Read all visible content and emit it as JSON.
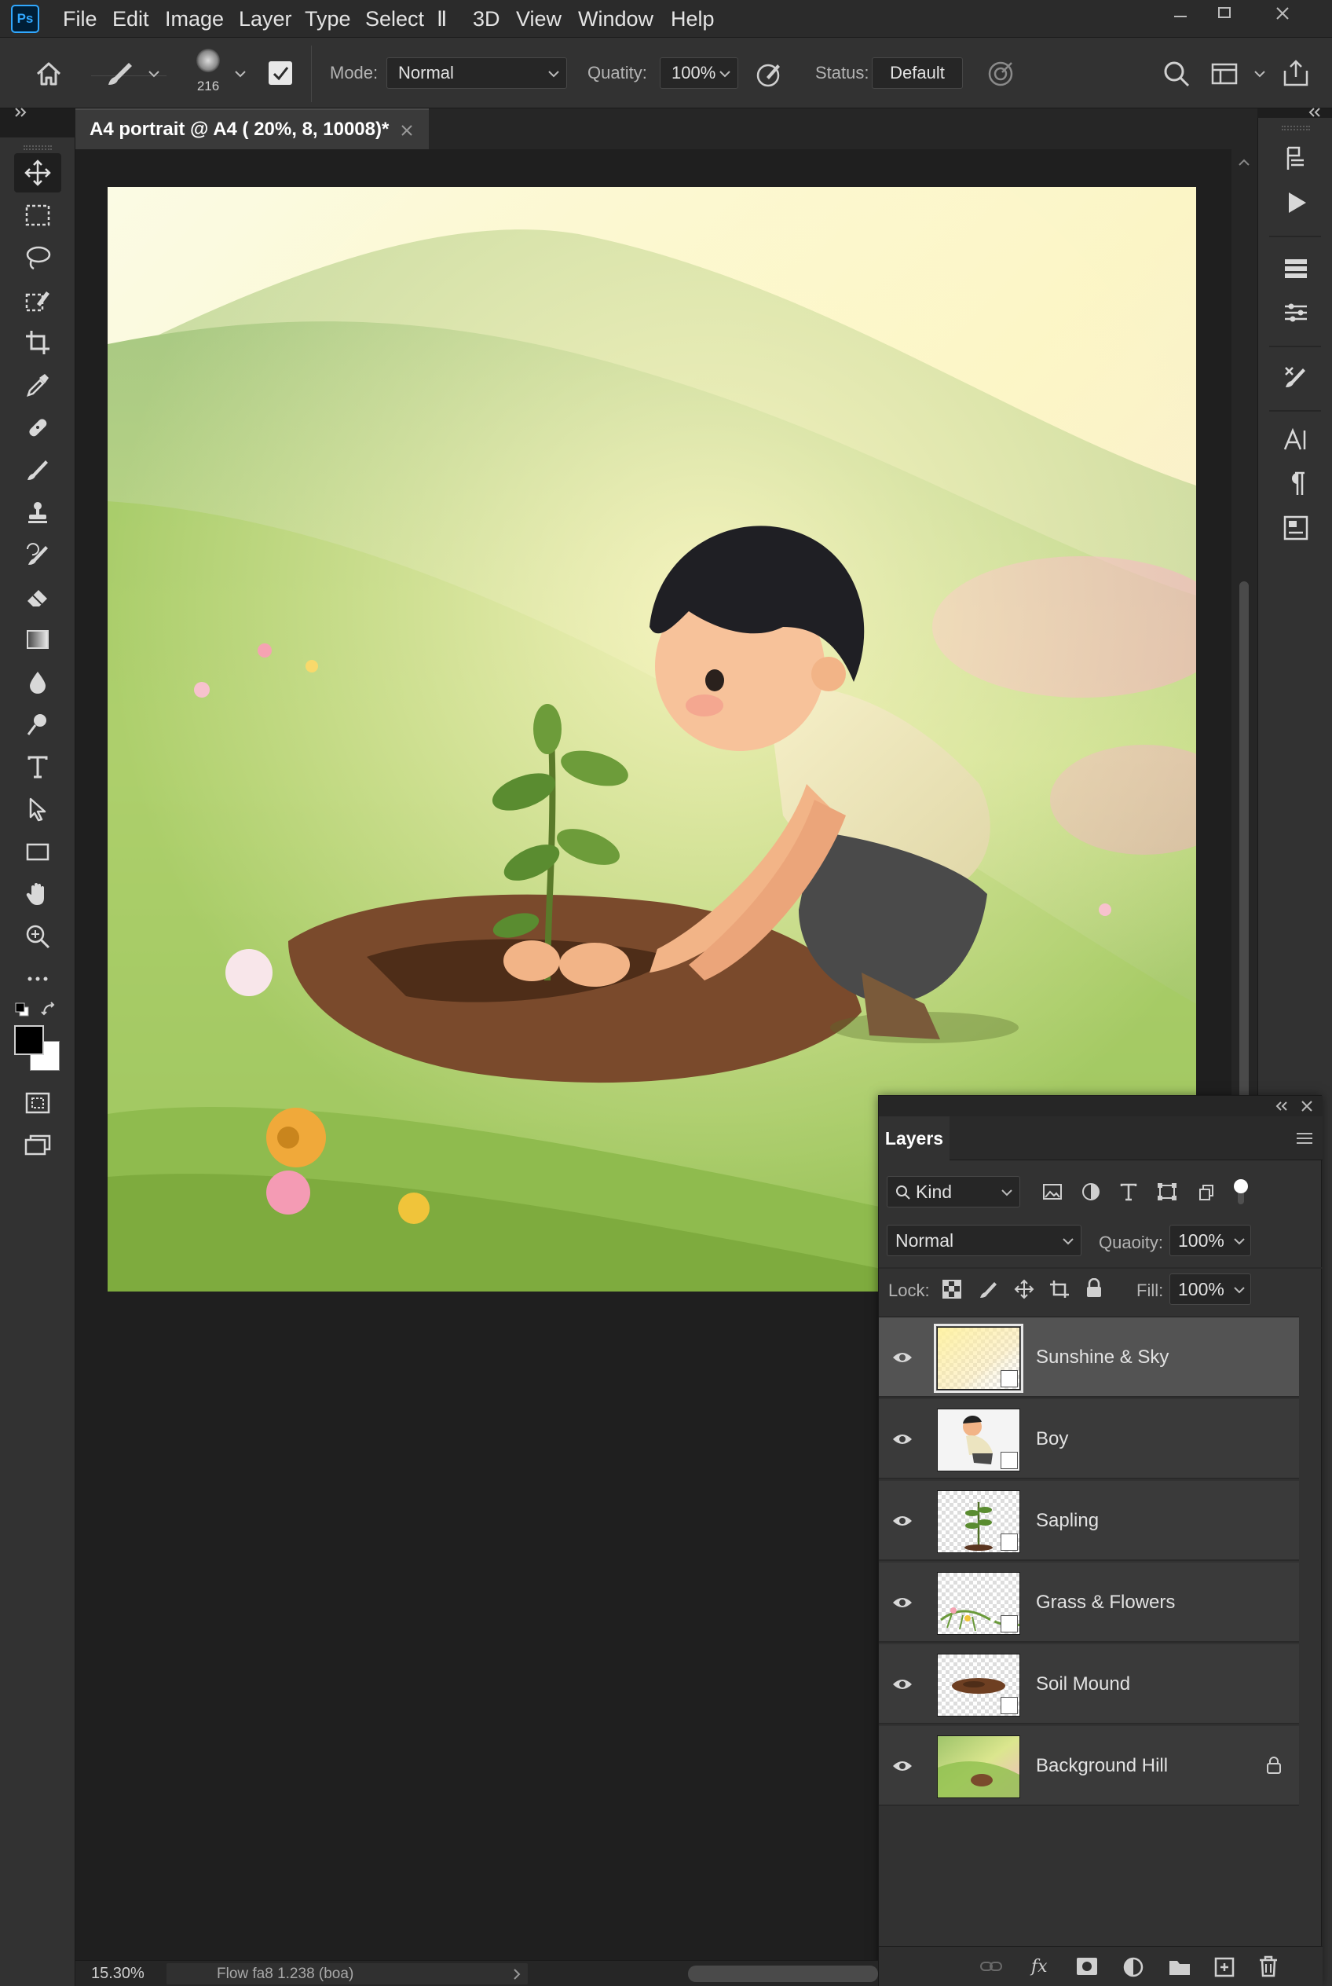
{
  "app": {
    "logo": "Ps"
  },
  "menu": {
    "items": [
      "File",
      "Edit",
      "Image",
      "Layer",
      "Type",
      "Select",
      "Ⅱ",
      "3D",
      "View",
      "Window",
      "Help"
    ]
  },
  "options_bar": {
    "brush_size": "216",
    "mode_label": "Mode:",
    "mode_value": "Normal",
    "quality_label": "Quatity:",
    "quality_value": "100%",
    "status_label": "Status:",
    "status_value": "Default"
  },
  "document": {
    "tab_title": "A4 portrait @ A4 ( 20%, 8, 10008)*",
    "zoom": "15.30%",
    "info": "Flow fa8 1.238 (boa)"
  },
  "colors": {
    "accent": "#31a8ff",
    "foreground_swatch": "#000000",
    "background_swatch": "#ffffff"
  },
  "toolbar": {
    "tools": [
      "move-tool",
      "marquee-tool",
      "lasso-tool",
      "quick-selection-tool",
      "crop-tool",
      "eyedropper-tool",
      "healing-brush-tool",
      "brush-tool",
      "clone-stamp-tool",
      "history-brush-tool",
      "eraser-tool",
      "gradient-tool",
      "blur-tool",
      "dodge-tool",
      "type-tool",
      "path-selection-tool",
      "rectangle-tool",
      "hand-tool",
      "zoom-tool",
      "more-tools"
    ]
  },
  "layers_panel": {
    "tab": "Layers",
    "filter_label": "Kind",
    "blend_mode": "Normal",
    "opacity_label": "Quaoity:",
    "opacity_value": "100%",
    "lock_label": "Lock:",
    "fill_label": "Fill:",
    "fill_value": "100%",
    "layers": [
      {
        "name": "Sunshine & Sky",
        "selected": true,
        "locked": false
      },
      {
        "name": "Boy",
        "selected": false,
        "locked": false
      },
      {
        "name": "Sapling",
        "selected": false,
        "locked": false
      },
      {
        "name": "Grass & Flowers",
        "selected": false,
        "locked": false
      },
      {
        "name": "Soil Mound",
        "selected": false,
        "locked": false
      },
      {
        "name": "Background Hill",
        "selected": false,
        "locked": true
      }
    ]
  }
}
